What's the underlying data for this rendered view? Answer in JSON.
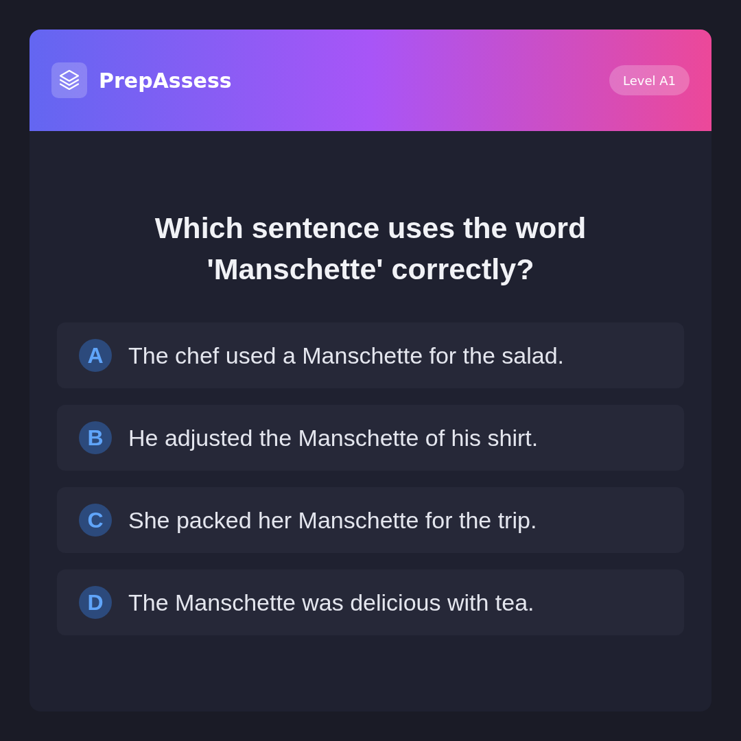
{
  "header": {
    "brand": "PrepAssess",
    "badge": "Level A1"
  },
  "question": "Which sentence uses the word 'Manschette' correctly?",
  "options": [
    {
      "letter": "A",
      "text": "The chef used a Manschette for the salad.",
      "selected": false
    },
    {
      "letter": "B",
      "text": "He adjusted the Manschette of his shirt.",
      "selected": false
    },
    {
      "letter": "C",
      "text": "She packed her Manschette for the trip.",
      "selected": false
    },
    {
      "letter": "D",
      "text": "The Manschette was delicious with tea.",
      "selected": false
    }
  ]
}
